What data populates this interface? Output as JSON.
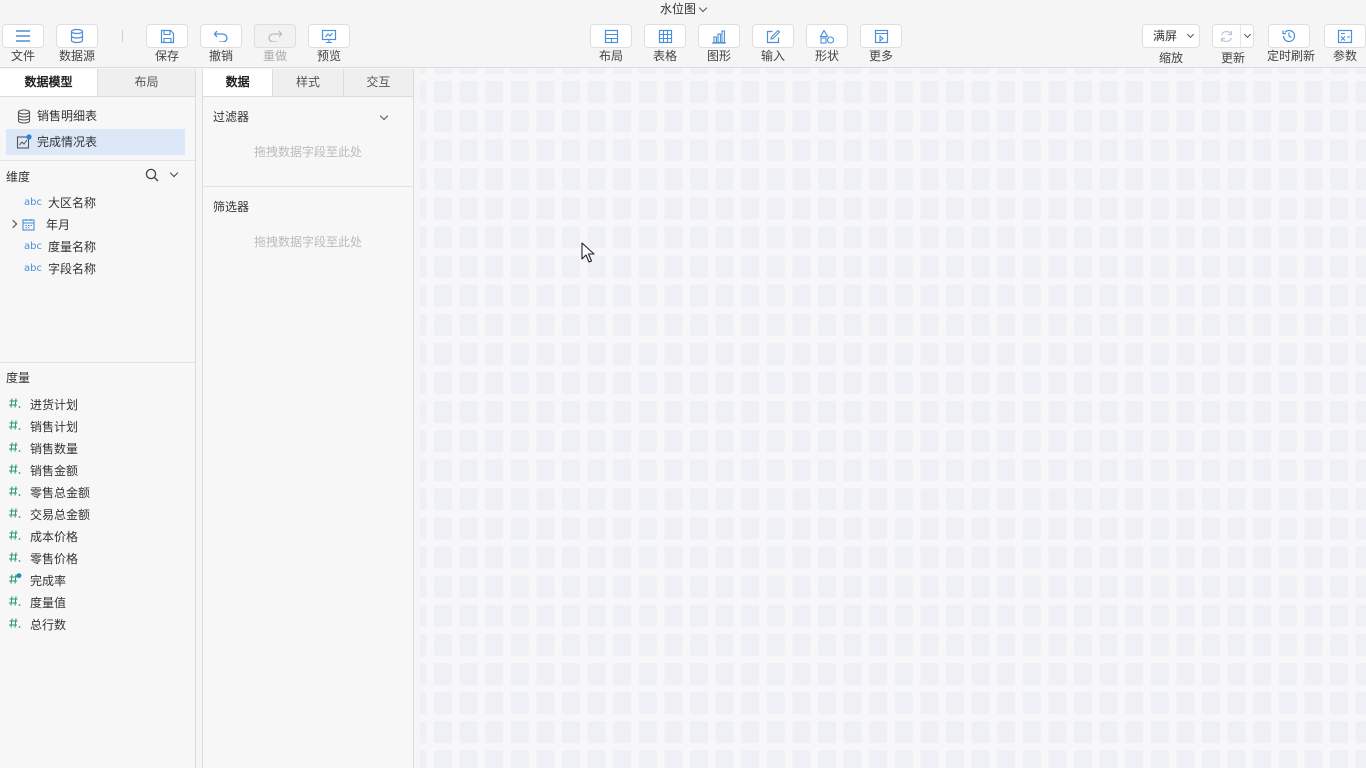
{
  "title": "水位图",
  "toolbar": {
    "file": "文件",
    "datasource": "数据源",
    "save": "保存",
    "undo": "撤销",
    "redo": "重做",
    "preview": "预览",
    "layout": "布局",
    "table": "表格",
    "chart": "图形",
    "input": "输入",
    "shape": "形状",
    "more": "更多",
    "zoom_value": "满屏",
    "zoom_label": "缩放",
    "refresh": "更新",
    "scheduled_refresh": "定时刷新",
    "params": "参数"
  },
  "left": {
    "tabs": [
      "数据模型",
      "布局"
    ],
    "models": [
      "销售明细表",
      "完成情况表"
    ],
    "dimension_title": "维度",
    "dimensions": [
      "大区名称",
      "年月",
      "度量名称",
      "字段名称"
    ],
    "dimension_tag": "abc",
    "measure_title": "度量",
    "measures": [
      "进货计划",
      "销售计划",
      "销售数量",
      "销售金额",
      "零售总金额",
      "交易总金额",
      "成本价格",
      "零售价格",
      "完成率",
      "度量值",
      "总行数"
    ]
  },
  "middle": {
    "tabs": [
      "数据",
      "样式",
      "交互"
    ],
    "filter_title": "过滤器",
    "filter_hint": "拖拽数据字段至此处",
    "selector_title": "筛选器",
    "selector_hint": "拖拽数据字段至此处"
  },
  "colors": {
    "accent": "#4a8fd8",
    "measure_icon": "#2e9a6e",
    "selected_row": "#dce8f8",
    "canvas_cell": "#eef0f5"
  }
}
